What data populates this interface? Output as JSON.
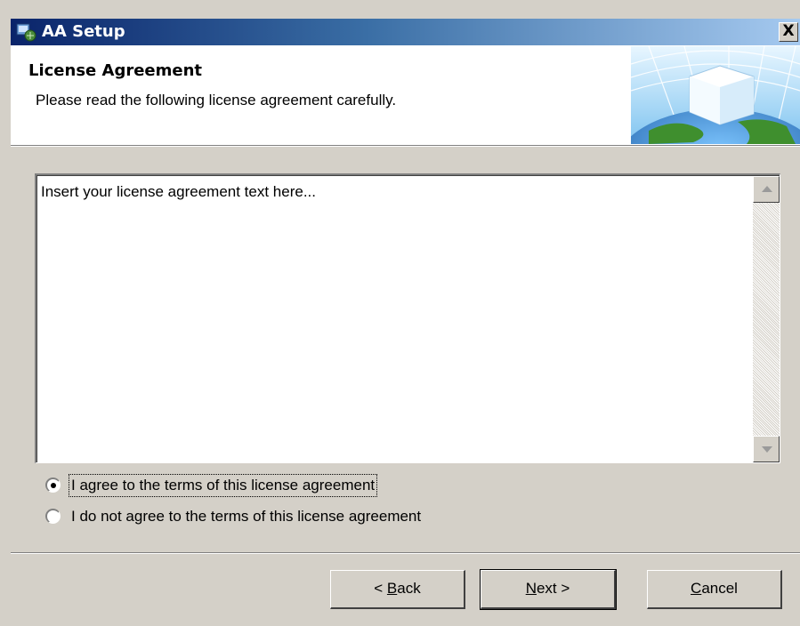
{
  "window": {
    "title": "AA Setup",
    "close_label": "X"
  },
  "header": {
    "title": "License Agreement",
    "subtitle": "Please read the following license agreement carefully."
  },
  "license": {
    "text": "Insert your license agreement text here..."
  },
  "options": [
    {
      "label": "I agree to the terms of this license agreement",
      "selected": true
    },
    {
      "label": "I do not agree to the terms of this license agreement",
      "selected": false
    }
  ],
  "buttons": {
    "back": {
      "prefix": "< ",
      "mnemonic": "B",
      "rest": "ack"
    },
    "next": {
      "prefix": "",
      "mnemonic": "N",
      "rest": "ext >"
    },
    "cancel": {
      "prefix": "",
      "mnemonic": "C",
      "rest": "ancel"
    }
  },
  "colors": {
    "titlebar_start": "#0a246a",
    "titlebar_end": "#a6caf0",
    "dialog_bg": "#d4d0c8"
  },
  "icons": [
    "setup-app-icon",
    "close-icon",
    "globe-cube-banner-art",
    "scroll-up-arrow-icon",
    "scroll-down-arrow-icon"
  ]
}
